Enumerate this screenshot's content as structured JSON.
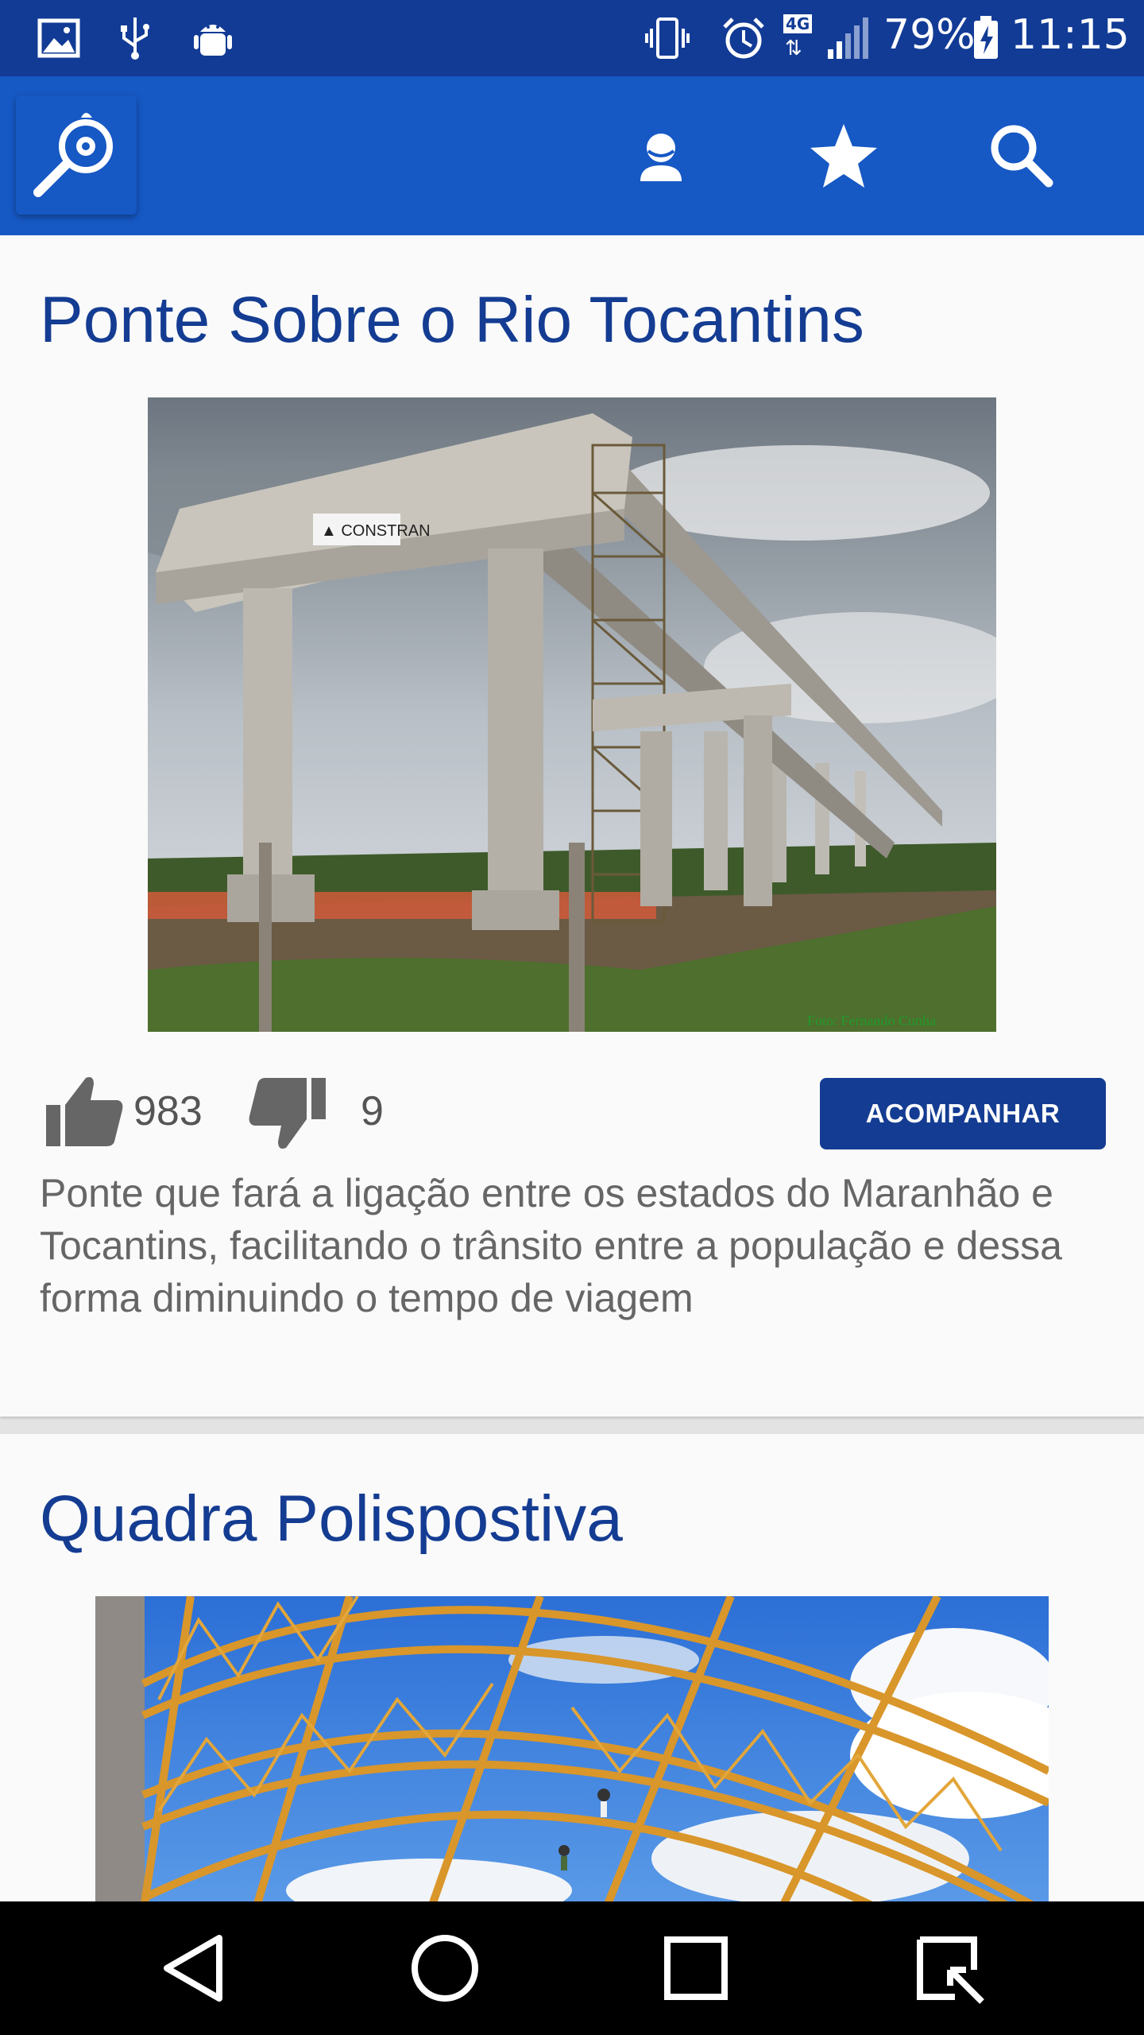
{
  "status_bar": {
    "icons_left": [
      "image-notification-icon",
      "usb-icon",
      "android-debug-icon"
    ],
    "icons_right": [
      "vibrate-icon",
      "alarm-icon",
      "network-4g-icon",
      "signal-icon",
      "battery-charging-icon"
    ],
    "network": "4G",
    "battery": "79%",
    "time": "11:15"
  },
  "app_bar": {
    "logo_icon": "magnifier-logo-icon",
    "actions": [
      "profile-icon",
      "star-icon",
      "search-icon"
    ],
    "brand_color": "#1658c4",
    "status_color": "#123b96"
  },
  "cards": [
    {
      "title": "Ponte Sobre o Rio Tocantins",
      "image_watermark": "Foto: Fernando Cunha",
      "likes": "983",
      "dislikes": "9",
      "follow_label": "ACOMPANHAR",
      "description": "Ponte que fará a ligação entre os estados do Maranhão e Tocantins, facilitando o trânsito entre a população e dessa forma diminuindo o tempo de viagem"
    },
    {
      "title": "Quadra Polispostiva"
    }
  ],
  "nav_bar": [
    "back-icon",
    "home-icon",
    "recents-icon",
    "screenshot-icon"
  ],
  "accent_color": "#143c92"
}
